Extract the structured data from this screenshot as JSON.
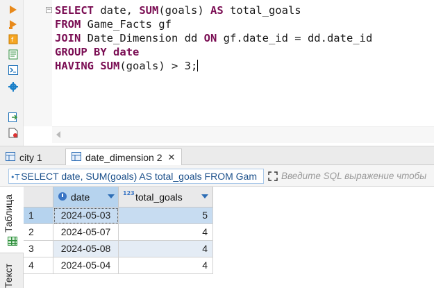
{
  "editor": {
    "lines": [
      [
        {
          "t": "SELECT",
          "k": true
        },
        {
          "t": " date, "
        },
        {
          "t": "SUM",
          "k": true
        },
        {
          "t": "(goals) "
        },
        {
          "t": "AS",
          "k": true
        },
        {
          "t": " total_goals"
        }
      ],
      [
        {
          "t": "FROM",
          "k": true
        },
        {
          "t": " Game_Facts gf"
        }
      ],
      [
        {
          "t": "JOIN",
          "k": true
        },
        {
          "t": " Date_Dimension dd "
        },
        {
          "t": "ON",
          "k": true
        },
        {
          "t": " gf.date_id = dd.date_id"
        }
      ],
      [
        {
          "t": "GROUP",
          "k": true
        },
        {
          "t": " "
        },
        {
          "t": "BY",
          "k": true
        },
        {
          "t": " "
        },
        {
          "t": "date",
          "k": true
        }
      ],
      [
        {
          "t": "HAVING",
          "k": true
        },
        {
          "t": " "
        },
        {
          "t": "SUM",
          "k": true
        },
        {
          "t": "(goals) > 3;"
        }
      ]
    ],
    "fold_symbol": "−",
    "toolbar_icons": [
      "execute-icon",
      "execute-script-icon",
      "explain-icon",
      "format-icon",
      "console-icon",
      "settings-icon",
      "export-icon",
      "file-icon"
    ]
  },
  "results_tabs": [
    {
      "label": "city 1",
      "active": false
    },
    {
      "label": "date_dimension 2",
      "active": true,
      "close": "✕"
    }
  ],
  "query": {
    "icon": "•T",
    "text": "SELECT date, SUM(goals) AS total_goals FROM Gam",
    "filter_placeholder": "Введите SQL выражение чтобы"
  },
  "side_tabs": {
    "table": "Таблица",
    "text": "Текст"
  },
  "grid": {
    "columns": [
      {
        "name": "date",
        "icon": "clock-icon"
      },
      {
        "name": "total_goals",
        "icon": "123"
      }
    ],
    "rows": [
      {
        "num": "1",
        "date": "2024-05-03",
        "total_goals": "5"
      },
      {
        "num": "2",
        "date": "2024-05-07",
        "total_goals": "4"
      },
      {
        "num": "3",
        "date": "2024-05-08",
        "total_goals": "4"
      },
      {
        "num": "4",
        "date": "2024-05-04",
        "total_goals": "4"
      }
    ]
  },
  "colors": {
    "keyword": "#7a0d53",
    "selection": "#b6d3ee",
    "alt_row": "#e4ecf5",
    "accent": "#2d6db5"
  }
}
